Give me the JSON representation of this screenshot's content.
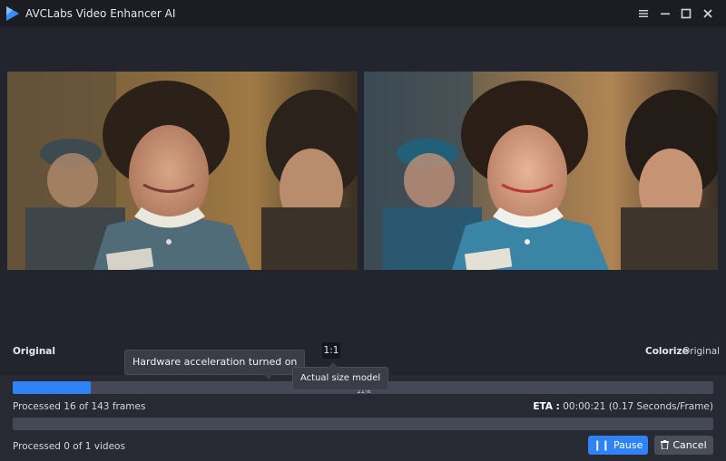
{
  "window": {
    "title": "AVCLabs Video Enhancer AI"
  },
  "icons": {
    "logo": "play-triangle-logo",
    "menu": "hamburger-icon",
    "minimize": "minimize-icon",
    "maximize": "maximize-icon",
    "close": "close-icon",
    "pause": "pause-icon",
    "cancel": "trash-icon"
  },
  "colors": {
    "accent": "#2f83f7",
    "background": "#22252d",
    "titlebar": "#1b1d23"
  },
  "preview": {
    "left_label": "Original",
    "right_label_active": "Colorize",
    "right_label_other": "Original",
    "ratio_button": "1:1"
  },
  "tooltips": {
    "hardware": "Hardware acceleration turned on",
    "actual_size": "Actual size model"
  },
  "progress": {
    "frames_text": "Processed 16 of 143 frames",
    "frames_fraction": 0.112,
    "frames_percent": "11%",
    "eta_label": "ETA :",
    "eta_value": "00:00:21 (0.17 Seconds/Frame)",
    "videos_text": "Processed 0 of 1 videos",
    "videos_fraction": 0
  },
  "buttons": {
    "pause": "Pause",
    "cancel": "Cancel"
  }
}
